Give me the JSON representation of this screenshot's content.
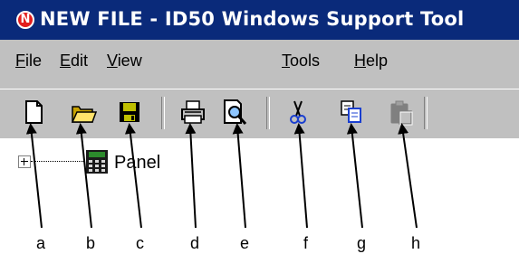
{
  "window": {
    "title": "NEW FILE - ID50 Windows Support Tool"
  },
  "menu": [
    {
      "label": "File",
      "mnemonic": "F",
      "rest": "ile"
    },
    {
      "label": "Edit",
      "mnemonic": "E",
      "rest": "dit"
    },
    {
      "label": "View",
      "mnemonic": "V",
      "rest": "iew"
    },
    {
      "label": "Tools",
      "mnemonic": "T",
      "rest": "ools"
    },
    {
      "label": "Help",
      "mnemonic": "H",
      "rest": "elp"
    }
  ],
  "toolbar": {
    "buttons": [
      {
        "icon": "new-file-icon"
      },
      {
        "icon": "open-folder-icon"
      },
      {
        "icon": "save-disk-icon"
      },
      {
        "icon": "printer-icon"
      },
      {
        "icon": "print-preview-icon"
      },
      {
        "icon": "cut-scissors-icon"
      },
      {
        "icon": "copy-icon"
      },
      {
        "icon": "paste-icon",
        "state": "disabled"
      }
    ]
  },
  "tree": {
    "root_label": "Panel"
  },
  "callouts": [
    "a",
    "b",
    "c",
    "d",
    "e",
    "f",
    "g",
    "h"
  ],
  "colors": {
    "titlebar": "#0a2a7a",
    "chrome": "#c0c0c0",
    "logo_red": "#e21d1d"
  }
}
